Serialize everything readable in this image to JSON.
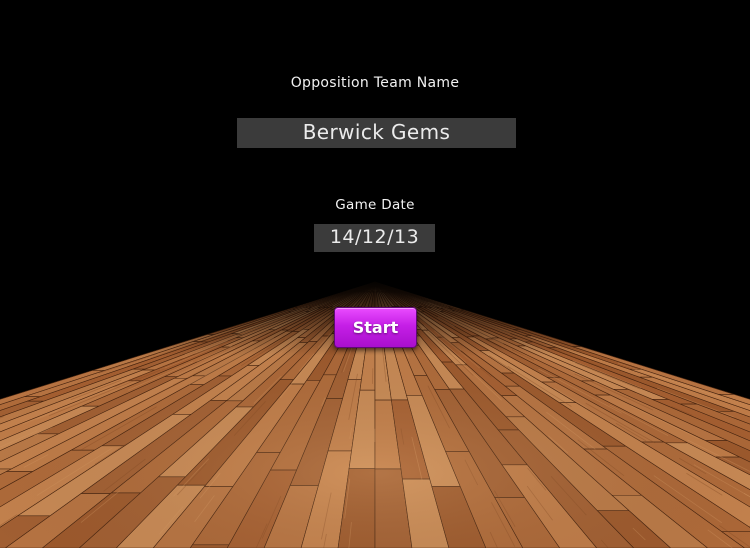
{
  "form": {
    "team_name_label": "Opposition Team Name",
    "team_name_value": "Berwick Gems",
    "game_date_label": "Game Date",
    "game_date_value": "14/12/13"
  },
  "actions": {
    "start_label": "Start"
  },
  "colors": {
    "background": "#000000",
    "field_background": "#3b3b3b",
    "start_button": "#c51fe6",
    "floor_wood": "#b87442"
  }
}
